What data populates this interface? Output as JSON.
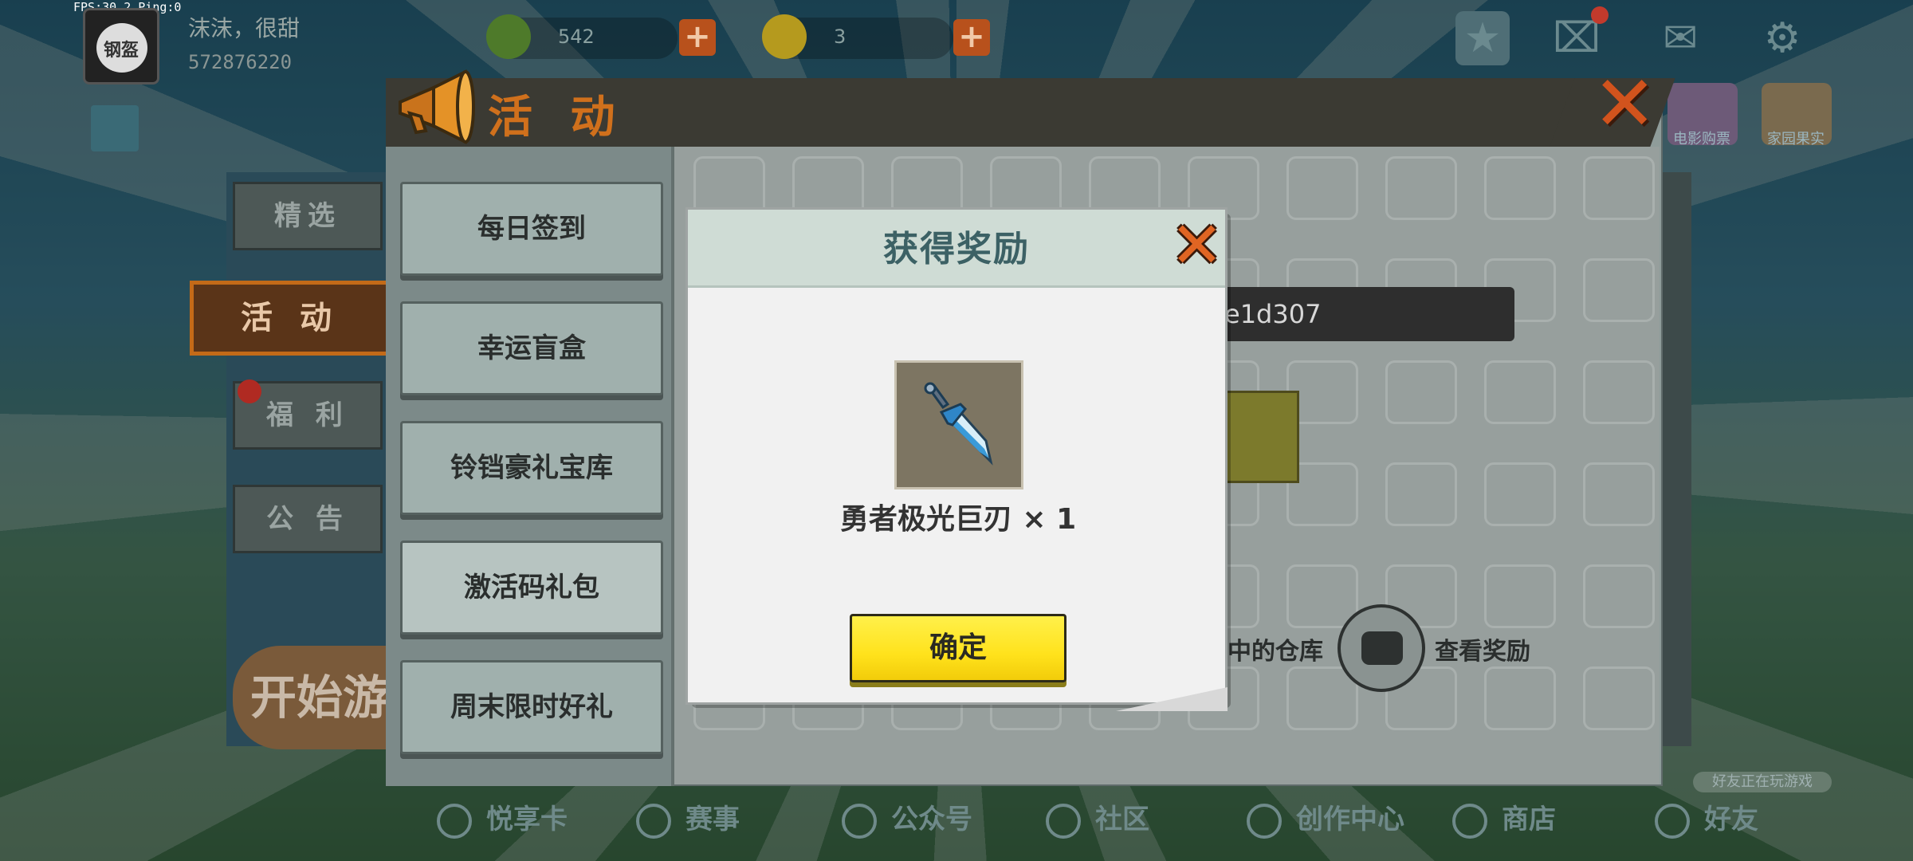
{
  "overlay": {
    "fps_text": "FPS:30.2  Ping:0"
  },
  "player": {
    "avatar_text": "钢盔",
    "name": "沫沫，很甜",
    "id": "572876220"
  },
  "currencies": [
    {
      "name": "mini-bean",
      "value": "542",
      "color": "#4e7a2a"
    },
    {
      "name": "mini-coin",
      "value": "3",
      "color": "#b59a1e"
    }
  ],
  "top_icons": [
    "star-icon",
    "gift-icon",
    "mail-icon",
    "gear-icon"
  ],
  "right_events": [
    {
      "label": "电影购票"
    },
    {
      "label": "家园果实"
    }
  ],
  "left_nav": {
    "items": [
      {
        "label": "精选"
      },
      {
        "label": "活 动"
      },
      {
        "label": "福 利"
      },
      {
        "label": "公 告"
      }
    ],
    "start_game": "开始游戏"
  },
  "activity_panel": {
    "title": "活 动",
    "menu": [
      {
        "label": "每日签到"
      },
      {
        "label": "幸运盲盒"
      },
      {
        "label": "铃铛豪礼宝库"
      },
      {
        "label": "激活码礼包"
      },
      {
        "label": "周末限时好礼"
      }
    ],
    "code_value": "e1d307",
    "warehouse_text": "中的仓库",
    "view_rewards": "查看奖励"
  },
  "dialog": {
    "title": "获得奖励",
    "item_name": "勇者极光巨刃 × 1",
    "confirm": "确定"
  },
  "bottom_nav": [
    {
      "label": "悦享卡"
    },
    {
      "label": "赛事"
    },
    {
      "label": "公众号"
    },
    {
      "label": "社区"
    },
    {
      "label": "创作中心"
    },
    {
      "label": "商店"
    },
    {
      "label": "好友"
    }
  ],
  "friends_playing": "好友正在玩游戏",
  "colors": {
    "accent_orange": "#d2531d",
    "confirm_yellow": "#ffe21c",
    "dialog_header": "#cfdcd5"
  }
}
